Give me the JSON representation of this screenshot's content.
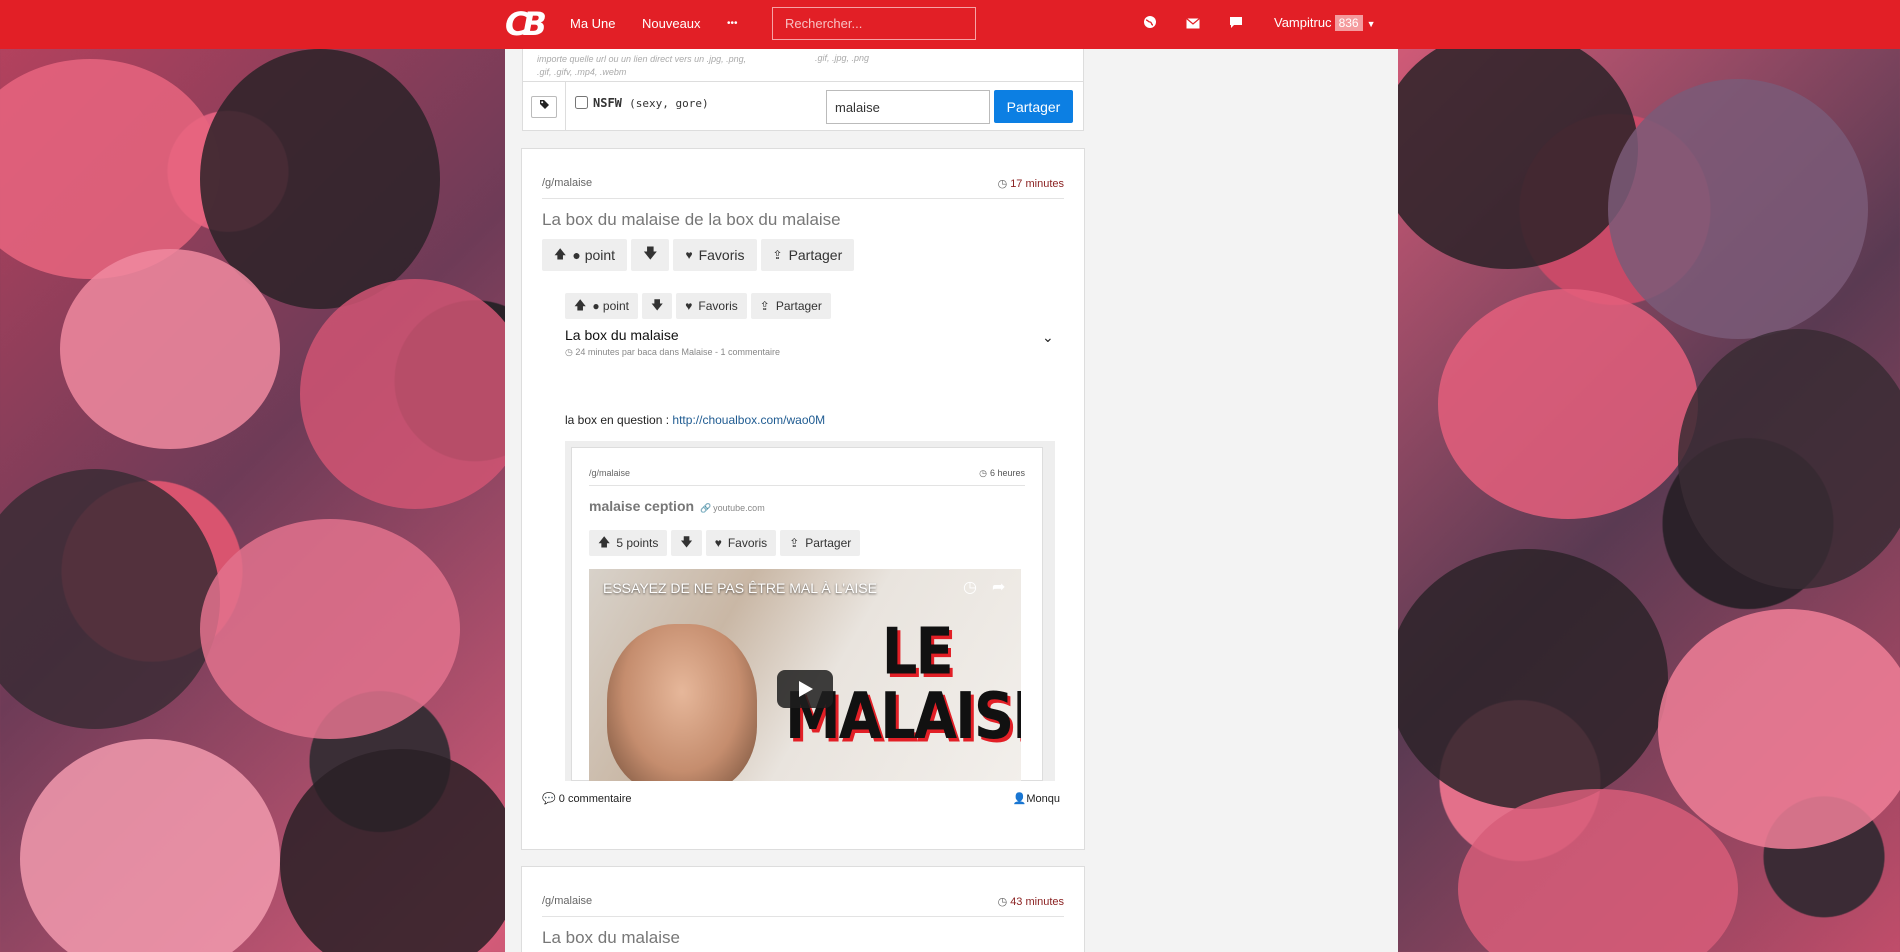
{
  "nav": {
    "logo": "CB",
    "links": [
      "Ma Une",
      "Nouveaux"
    ],
    "more": "•••",
    "search_placeholder": "Rechercher...",
    "icons": [
      "globe-icon",
      "mail-icon",
      "chat-icon"
    ],
    "user": "Vampitruc",
    "user_count": "836"
  },
  "upload": {
    "hint_line1": "importe quelle url ou un lien direct vers un .jpg, .png,",
    "hint_line2": ".gif, .gifv, .mp4, .webm",
    "hint_right": ".gif, .jpg, .png",
    "nsfw_label": "NSFW",
    "nsfw_detail": "(sexy, gore)",
    "tag_value": "malaise",
    "share_label": "Partager"
  },
  "post1": {
    "group": "/g/malaise",
    "time": "17 minutes",
    "title": "La box du malaise de la box du malaise",
    "votes": {
      "points": "● point",
      "fav": "Favoris",
      "share": "Partager"
    },
    "embed": {
      "votes": {
        "points": "● point",
        "fav": "Favoris",
        "share": "Partager"
      },
      "title": "La box du malaise",
      "meta": "24 minutes par baca dans Malaise - 1 commentaire",
      "text": "la box en question : ",
      "link": "http://choualbox.com/wao0M",
      "inner": {
        "group": "/g/malaise",
        "time": "6 heures",
        "title": "malaise ception",
        "source": "youtube.com",
        "votes": {
          "points": "5 points",
          "fav": "Favoris",
          "share": "Partager"
        },
        "video_title": "ESSAYEZ DE NE PAS ÊTRE MAL À L'AISE",
        "video_big_line1": "LE",
        "video_big_line2": "MALAISE"
      }
    },
    "comments": "0 commentaire",
    "author": "Monqu"
  },
  "post2": {
    "group": "/g/malaise",
    "time": "43 minutes",
    "title": "La box du malaise"
  },
  "colors": {
    "brand": "#e21f26",
    "share": "#0c7fe3"
  }
}
